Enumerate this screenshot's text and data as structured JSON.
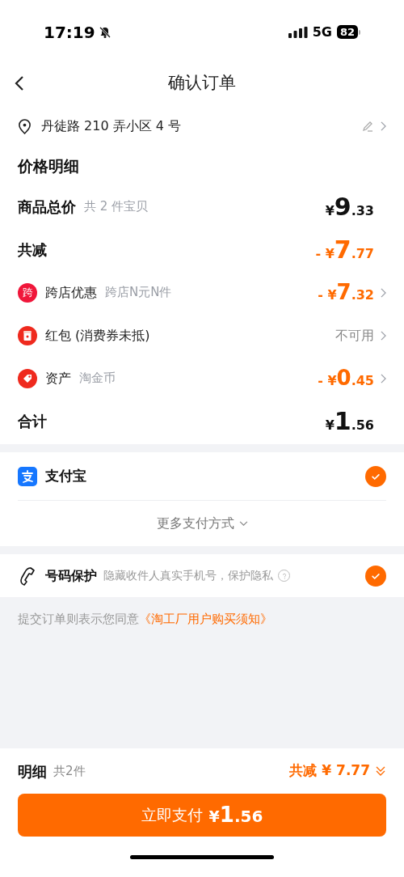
{
  "status_bar": {
    "time": "17:19",
    "network": "5G",
    "battery": "82"
  },
  "header": {
    "title": "确认订单"
  },
  "address": {
    "text": "丹徒路 210 弄小区 4 号"
  },
  "price_detail": {
    "title": "价格明细",
    "rows": [
      {
        "kind": "plain",
        "label": "商品总价",
        "note": "共 2 件宝贝",
        "color": "#111111",
        "prefix": "¥",
        "integer": "9",
        "decimal": ".33",
        "chevron": false
      },
      {
        "kind": "plain",
        "label": "共减",
        "color": "#ff6a00",
        "prefix": "- ¥",
        "integer": "7",
        "decimal": ".77",
        "chevron": false
      },
      {
        "kind": "badge",
        "badge": "跨",
        "label": "跨店优惠",
        "note": "跨店N元N件",
        "color": "#ff6a00",
        "prefix": "- ¥",
        "integer": "7",
        "decimal": ".32",
        "chevron": true
      },
      {
        "kind": "envelope",
        "label": "红包 (消费券未抵)",
        "status": "不可用",
        "chevron": true
      },
      {
        "kind": "tag",
        "label": "资产",
        "note": "淘金币",
        "color": "#ff6a00",
        "prefix": "- ¥",
        "integer": "0",
        "decimal": ".45",
        "chevron": true
      },
      {
        "kind": "plain",
        "label": "合计",
        "color": "#111111",
        "prefix": "¥",
        "integer": "1",
        "decimal": ".56",
        "chevron": false
      }
    ]
  },
  "payment": {
    "method": "支付宝",
    "selected": true,
    "more": "更多支付方式"
  },
  "number_protection": {
    "title": "号码保护",
    "description": "隐藏收件人真实手机号，保护隐私",
    "checked": true
  },
  "agreement": {
    "text": "提交订单则表示您同意",
    "link": "《淘工厂用户购买须知》"
  },
  "footer": {
    "detail_label": "明细",
    "count": "共2件",
    "discount": "共减 ¥ 7.77",
    "pay_button": {
      "label": "立即支付",
      "currency": "¥",
      "integer": "1",
      "decimal": ".56"
    }
  }
}
